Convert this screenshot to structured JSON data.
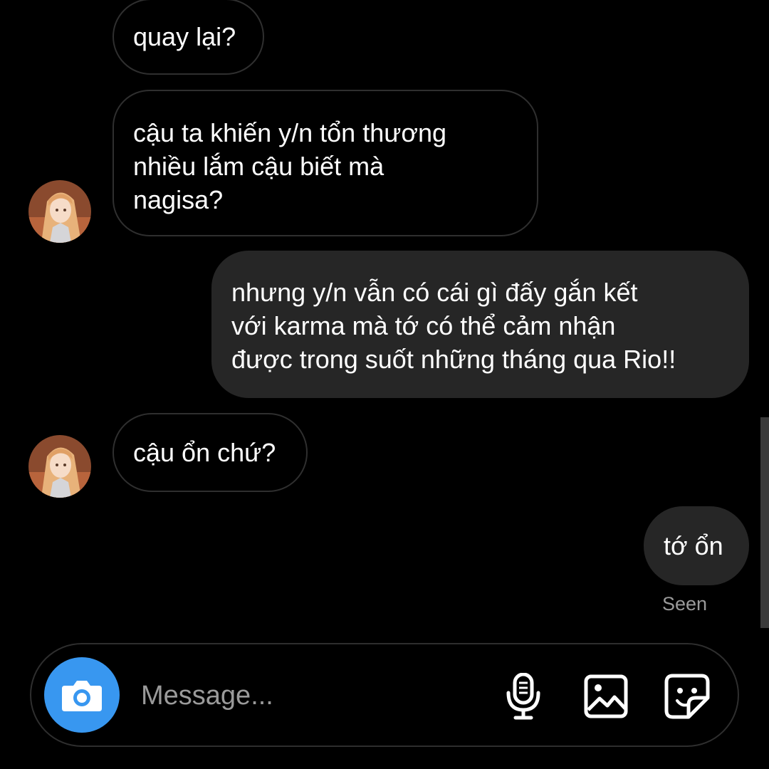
{
  "messages": [
    {
      "id": "m1",
      "direction": "incoming",
      "text": "quay lại?"
    },
    {
      "id": "m2",
      "direction": "incoming",
      "lines": [
        "cậu ta khiến y/n tổn thương",
        "nhiều lắm cậu biết mà",
        "nagisa?"
      ]
    },
    {
      "id": "m3",
      "direction": "outgoing",
      "lines": [
        "nhưng y/n vẫn có cái gì đấy gắn kết",
        "với karma mà tớ có thể cảm nhận",
        "được trong suốt những tháng qua Rio!!"
      ]
    },
    {
      "id": "m4",
      "direction": "incoming",
      "text": "cậu ổn chứ?"
    },
    {
      "id": "m5",
      "direction": "outgoing",
      "text": "tớ ổn"
    }
  ],
  "seen_label": "Seen",
  "composer": {
    "placeholder": "Message...",
    "icons": [
      "camera-icon",
      "microphone-icon",
      "image-icon",
      "sticker-icon"
    ]
  },
  "colors": {
    "background": "#000000",
    "incoming_border": "#2f2f2f",
    "outgoing_bubble": "#262626",
    "accent": "#3897f0",
    "muted_text": "#9a9a9a"
  }
}
